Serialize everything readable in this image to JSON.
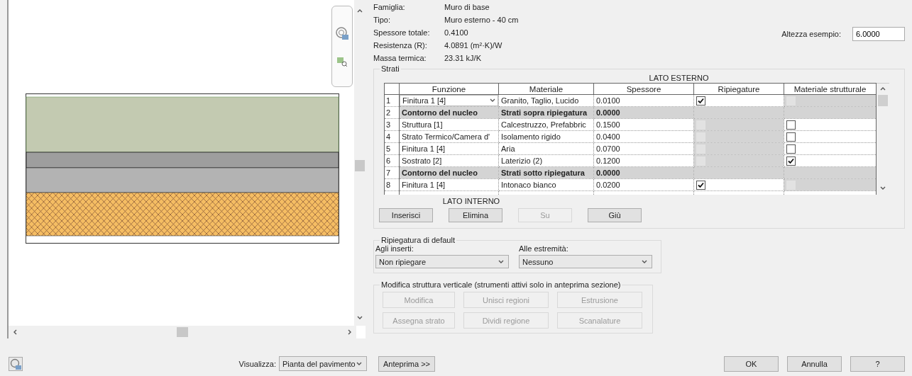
{
  "preview": {
    "view_label": "Visualizza:",
    "view_select": "Pianta del pavimento"
  },
  "properties": [
    {
      "label": "Famiglia:",
      "value": "Muro di base"
    },
    {
      "label": "Tipo:",
      "value": "Muro esterno - 40 cm"
    },
    {
      "label": "Spessore totale:",
      "value": "0.4100"
    },
    {
      "label": "Resistenza (R):",
      "value": "4.0891 (m²·K)/W"
    },
    {
      "label": "Massa termica:",
      "value": "23.31 kJ/K"
    }
  ],
  "sample_height": {
    "label": "Altezza esempio:",
    "value": "6.0000"
  },
  "layers": {
    "title": "Strati",
    "exterior_label": "LATO ESTERNO",
    "interior_label": "LATO INTERNO",
    "columns": [
      "Funzione",
      "Materiale",
      "Spessore",
      "Ripiegature",
      "Materiale strutturale"
    ],
    "rows": [
      {
        "number": "1",
        "kind": "layer",
        "editing": true,
        "function": "Finitura 1 [4]",
        "material": "Granito, Taglio, Lucido",
        "thickness": "0.0100",
        "wraps": {
          "checked": true,
          "disabled": false
        },
        "structural": {
          "checked": false,
          "disabled": true
        }
      },
      {
        "number": "2",
        "kind": "core_boundary",
        "editing": false,
        "function": "Contorno del nucleo",
        "material": "Strati sopra ripiegatura",
        "thickness": "0.0000"
      },
      {
        "number": "3",
        "kind": "layer",
        "editing": false,
        "function": "Struttura [1]",
        "material": "Calcestruzzo, Prefabbric",
        "thickness": "0.1500",
        "wraps": {
          "checked": false,
          "disabled": true
        },
        "structural": {
          "checked": false,
          "disabled": false
        }
      },
      {
        "number": "4",
        "kind": "layer",
        "editing": false,
        "function": "Strato Termico/Camera d'",
        "material": "Isolamento rigido",
        "thickness": "0.0400",
        "wraps": {
          "checked": false,
          "disabled": true
        },
        "structural": {
          "checked": false,
          "disabled": false
        }
      },
      {
        "number": "5",
        "kind": "layer",
        "editing": false,
        "function": "Finitura 1 [4]",
        "material": "Aria",
        "thickness": "0.0700",
        "wraps": {
          "checked": false,
          "disabled": true
        },
        "structural": {
          "checked": false,
          "disabled": false
        }
      },
      {
        "number": "6",
        "kind": "layer",
        "editing": false,
        "function": "Sostrato [2]",
        "material": "Laterizio (2)",
        "thickness": "0.1200",
        "wraps": {
          "checked": false,
          "disabled": true
        },
        "structural": {
          "checked": true,
          "disabled": false
        }
      },
      {
        "number": "7",
        "kind": "core_boundary",
        "editing": false,
        "function": "Contorno del nucleo",
        "material": "Strati sotto ripiegatura",
        "thickness": "0.0000"
      },
      {
        "number": "8",
        "kind": "layer",
        "editing": false,
        "function": "Finitura 1 [4]",
        "material": "Intonaco bianco",
        "thickness": "0.0200",
        "wraps": {
          "checked": true,
          "disabled": false
        },
        "structural": {
          "checked": false,
          "disabled": true
        }
      }
    ],
    "buttons": [
      {
        "label": "Inserisci",
        "disabled": false
      },
      {
        "label": "Elimina",
        "disabled": false
      },
      {
        "label": "Su",
        "disabled": true
      },
      {
        "label": "Giù",
        "disabled": false
      }
    ]
  },
  "default_wrapping": {
    "title": "Ripiegatura di default",
    "fields": [
      {
        "label": "Agli inserti:",
        "value": "Non ripiegare"
      },
      {
        "label": "Alle estremità:",
        "value": "Nessuno"
      }
    ]
  },
  "vertical_structure": {
    "title": "Modifica struttura verticale (strumenti attivi solo in anteprima sezione)",
    "buttons": [
      {
        "label": "Modifica",
        "disabled": true
      },
      {
        "label": "Unisci regioni",
        "disabled": true
      },
      {
        "label": "Estrusione",
        "disabled": true
      },
      {
        "label": "Assegna strato",
        "disabled": true
      },
      {
        "label": "Dividi regione",
        "disabled": true
      },
      {
        "label": "Scanalature",
        "disabled": true
      }
    ]
  },
  "preview_button": "Anteprima >>",
  "dialog_buttons": [
    "OK",
    "Annulla",
    "?"
  ]
}
